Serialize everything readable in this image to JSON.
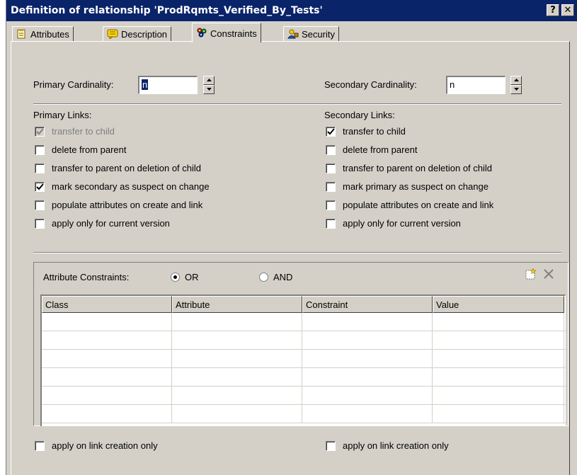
{
  "window": {
    "title": "Definition of relationship 'ProdRqmts_Verified_By_Tests'",
    "help_button": "?",
    "close_button": "✕"
  },
  "tabs": [
    {
      "label": "Attributes",
      "icon": "attributes-icon",
      "active": false
    },
    {
      "label": "Description",
      "icon": "description-icon",
      "active": false
    },
    {
      "label": "Constraints",
      "icon": "constraints-icon",
      "active": true
    },
    {
      "label": "Security",
      "icon": "security-icon",
      "active": false
    }
  ],
  "cardinality": {
    "primary_label": "Primary Cardinality:",
    "primary_value": "n",
    "secondary_label": "Secondary Cardinality:",
    "secondary_value": "n"
  },
  "primary_links": {
    "heading": "Primary Links:",
    "items": [
      {
        "label": "transfer to child",
        "checked": true,
        "disabled": true
      },
      {
        "label": "delete from parent",
        "checked": false,
        "disabled": false
      },
      {
        "label": "transfer to parent on deletion of child",
        "checked": false,
        "disabled": false
      },
      {
        "label": "mark secondary as suspect on change",
        "checked": true,
        "disabled": false
      },
      {
        "label": "populate attributes on create and link",
        "checked": false,
        "disabled": false
      },
      {
        "label": "apply only for current version",
        "checked": false,
        "disabled": false
      }
    ]
  },
  "secondary_links": {
    "heading": "Secondary Links:",
    "items": [
      {
        "label": "transfer to child",
        "checked": true,
        "disabled": false
      },
      {
        "label": "delete from parent",
        "checked": false,
        "disabled": false
      },
      {
        "label": "transfer to parent on deletion of child",
        "checked": false,
        "disabled": false
      },
      {
        "label": "mark primary as suspect on change",
        "checked": false,
        "disabled": false
      },
      {
        "label": "populate attributes on create and link",
        "checked": false,
        "disabled": false
      },
      {
        "label": "apply only for current version",
        "checked": false,
        "disabled": false
      }
    ]
  },
  "attribute_constraints": {
    "label": "Attribute Constraints:",
    "options": [
      {
        "label": "OR",
        "selected": true
      },
      {
        "label": "AND",
        "selected": false
      }
    ],
    "columns": [
      "Class",
      "Attribute",
      "Constraint",
      "Value"
    ],
    "rows": [
      [
        "",
        "",
        "",
        ""
      ],
      [
        "",
        "",
        "",
        ""
      ],
      [
        "",
        "",
        "",
        ""
      ],
      [
        "",
        "",
        "",
        ""
      ],
      [
        "",
        "",
        "",
        ""
      ],
      [
        "",
        "",
        "",
        ""
      ]
    ]
  },
  "footer": {
    "primary_apply_label": "apply on link creation only",
    "primary_apply_checked": false,
    "secondary_apply_label": "apply on link creation only",
    "secondary_apply_checked": false
  },
  "colors": {
    "titlebar": "#0a246a",
    "dialog_face": "#d4d0c8",
    "selection": "#0a246a"
  }
}
